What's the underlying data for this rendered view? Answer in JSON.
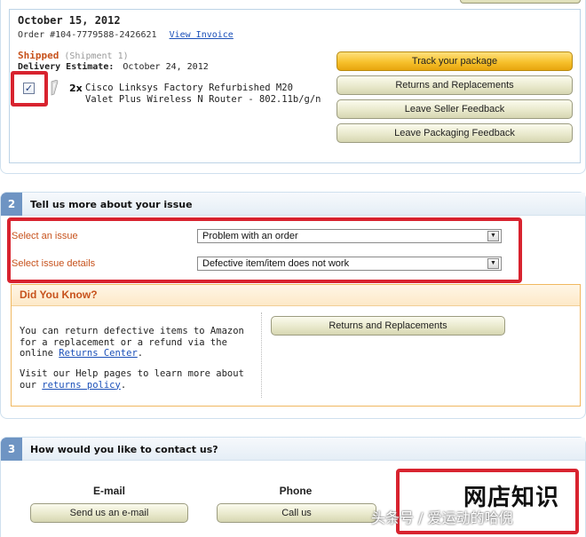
{
  "order": {
    "date": "October 15, 2012",
    "number": "Order #104-7779588-2426621",
    "view_invoice": "View Invoice",
    "shipped": "Shipped",
    "shipment": "(Shipment 1)",
    "delivery_label": "Delivery Estimate:",
    "delivery_date": "October 24, 2012",
    "checked": "✓",
    "product_qty": "2x",
    "product_name": "Cisco Linksys Factory Refurbished M20 Valet Plus Wireless N Router - 802.11b/g/n"
  },
  "actions": {
    "track": "Track your package",
    "returns": "Returns and Replacements",
    "seller_feedback": "Leave Seller Feedback",
    "packaging_feedback": "Leave Packaging Feedback"
  },
  "section2": {
    "number": "2",
    "title": "Tell us more about your issue",
    "issue_label": "Select an issue",
    "issue_value": "Problem with an order",
    "details_label": "Select issue details",
    "details_value": "Defective item/item does not work"
  },
  "did_you_know": {
    "title": "Did You Know?",
    "text1": "You can return defective items to Amazon for a replacement or a refund via the online",
    "link1": "Returns Center",
    "text1_end": ".",
    "text2": "Visit our Help pages to learn more about our",
    "link2": "returns policy",
    "text2_end": ".",
    "button": "Returns and Replacements"
  },
  "section3": {
    "number": "3",
    "title": "How would you like to contact us?",
    "email_title": "E-mail",
    "email_button": "Send us an e-mail",
    "phone_title": "Phone",
    "phone_button": "Call us"
  },
  "watermark": {
    "main": "网店知识",
    "sub": "头条号 / 爱运动的哈倪"
  }
}
